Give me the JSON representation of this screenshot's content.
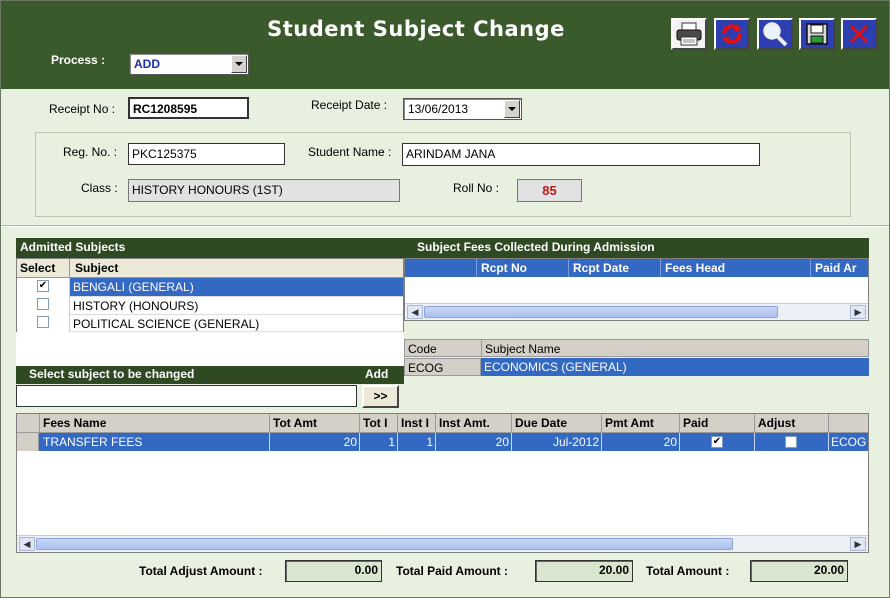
{
  "title": "Student Subject Change",
  "process": {
    "label": "Process :",
    "value": "ADD"
  },
  "receipt": {
    "no_label": "Receipt No :",
    "no_value": "RC1208595",
    "date_label": "Receipt Date :",
    "date_value": "13/06/2013"
  },
  "student": {
    "reg_label": "Reg. No. :",
    "reg_value": "PKC125375",
    "name_label": "Student Name :",
    "name_value": "ARINDAM JANA",
    "class_label": "Class :",
    "class_value": "HISTORY HONOURS (1ST)",
    "roll_label": "Roll No :",
    "roll_value": "85"
  },
  "admitted": {
    "title": "Admitted Subjects",
    "col_select": "Select",
    "col_subject": "Subject",
    "rows": [
      {
        "checked": "✔",
        "subject": "BENGALI (GENERAL)"
      },
      {
        "checked": "",
        "subject": "HISTORY (HONOURS)"
      },
      {
        "checked": "",
        "subject": "POLITICAL SCIENCE (GENERAL)"
      }
    ]
  },
  "fees_collected": {
    "title": "Subject Fees Collected During Admission",
    "columns": [
      "Rcpt No",
      "Rcpt Date",
      "Fees Head",
      "Paid Ar"
    ]
  },
  "change": {
    "title": "Select subject to be changed",
    "add_label": "Add",
    "add_button": ">>",
    "input_value": ""
  },
  "subject_list": {
    "col_code": "Code",
    "col_name": "Subject Name",
    "rows": [
      {
        "code": "ECOG",
        "name": "ECONOMICS (GENERAL)"
      }
    ]
  },
  "fees": {
    "columns": [
      "Fees Name",
      "Tot Amt",
      "Tot I",
      "Inst I",
      "Inst Amt.",
      "Due Date",
      "Pmt Amt",
      "Paid",
      "Adjust"
    ],
    "rows": [
      {
        "fees_name": "TRANSFER FEES",
        "tot_amt": "20",
        "tot_i": "1",
        "inst_i": "1",
        "inst_amt": "20",
        "due_date": "Jul-2012",
        "pmt_amt": "20",
        "paid": "✔",
        "adjust": "",
        "code": "ECOG"
      }
    ]
  },
  "totals": {
    "adjust_label": "Total Adjust Amount :",
    "adjust_value": "0.00",
    "paid_label": "Total Paid Amount :",
    "paid_value": "20.00",
    "total_label": "Total Amount :",
    "total_value": "20.00"
  },
  "icons": [
    "printer-icon",
    "refresh-icon",
    "search-icon",
    "save-icon",
    "close-icon"
  ]
}
